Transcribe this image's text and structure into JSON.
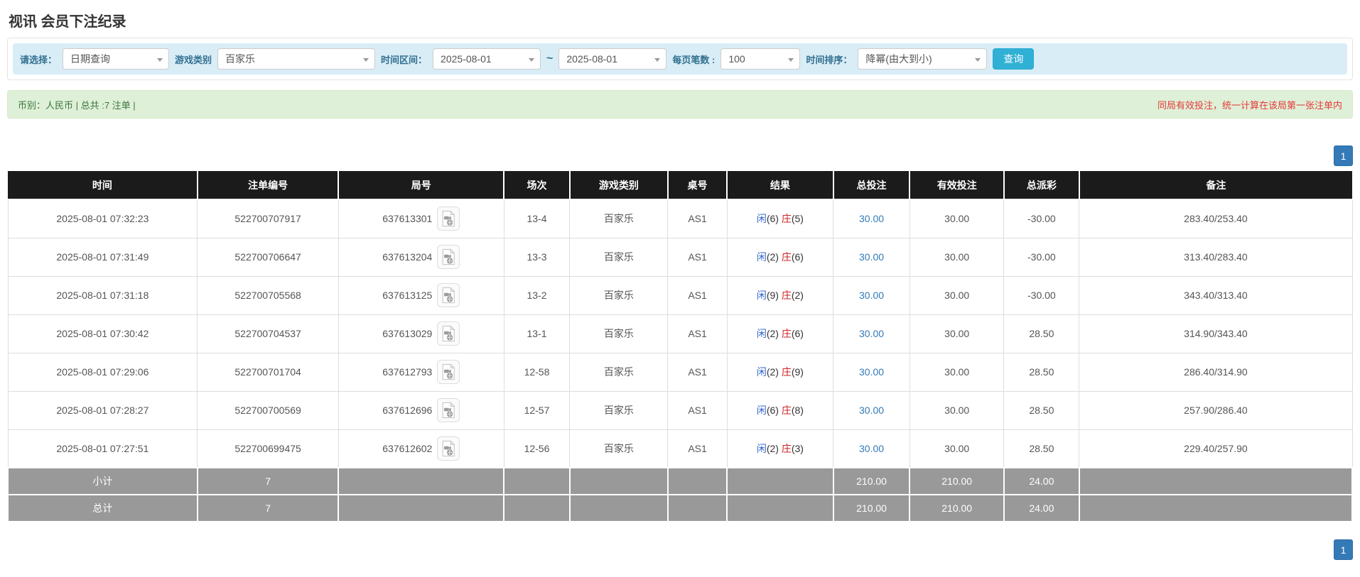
{
  "page": {
    "title": "视讯 会员下注纪录"
  },
  "filters": {
    "select_label": "请选择：",
    "select_value": "日期查询",
    "game_label": "游戏类别",
    "game_value": "百家乐",
    "range_label": "时间区间：",
    "date_from": "2025-08-01",
    "range_sep": "~",
    "date_to": "2025-08-01",
    "per_page_label": "每页笔数 :",
    "per_page_value": "100",
    "sort_label": "时间排序：",
    "sort_value": "降幂(由大到小)",
    "search_button": "查询"
  },
  "summary": {
    "left": "币别：人民币 | 总共 :7 注单 |",
    "right": "同局有效投注，统一计算在该局第一张注单内"
  },
  "pagination": {
    "page": "1"
  },
  "table": {
    "columns": [
      "时间",
      "注单编号",
      "局号",
      "场次",
      "游戏类别",
      "桌号",
      "结果",
      "总投注",
      "有效投注",
      "总派彩",
      "备注"
    ],
    "rows": [
      {
        "time": "2025-08-01 07:32:23",
        "bet_no": "522700707917",
        "round_no": "637613301",
        "session": "13-4",
        "game": "百家乐",
        "table_no": "AS1",
        "player_label": "闲",
        "player_num": "(6)",
        "banker_label": "庄",
        "banker_num": "(5)",
        "total_bet": "30.00",
        "valid_bet": "30.00",
        "payout": "-30.00",
        "remark": "283.40/253.40"
      },
      {
        "time": "2025-08-01 07:31:49",
        "bet_no": "522700706647",
        "round_no": "637613204",
        "session": "13-3",
        "game": "百家乐",
        "table_no": "AS1",
        "player_label": "闲",
        "player_num": "(2)",
        "banker_label": "庄",
        "banker_num": "(6)",
        "total_bet": "30.00",
        "valid_bet": "30.00",
        "payout": "-30.00",
        "remark": "313.40/283.40"
      },
      {
        "time": "2025-08-01 07:31:18",
        "bet_no": "522700705568",
        "round_no": "637613125",
        "session": "13-2",
        "game": "百家乐",
        "table_no": "AS1",
        "player_label": "闲",
        "player_num": "(9)",
        "banker_label": "庄",
        "banker_num": "(2)",
        "total_bet": "30.00",
        "valid_bet": "30.00",
        "payout": "-30.00",
        "remark": "343.40/313.40"
      },
      {
        "time": "2025-08-01 07:30:42",
        "bet_no": "522700704537",
        "round_no": "637613029",
        "session": "13-1",
        "game": "百家乐",
        "table_no": "AS1",
        "player_label": "闲",
        "player_num": "(2)",
        "banker_label": "庄",
        "banker_num": "(6)",
        "total_bet": "30.00",
        "valid_bet": "30.00",
        "payout": "28.50",
        "remark": "314.90/343.40"
      },
      {
        "time": "2025-08-01 07:29:06",
        "bet_no": "522700701704",
        "round_no": "637612793",
        "session": "12-58",
        "game": "百家乐",
        "table_no": "AS1",
        "player_label": "闲",
        "player_num": "(2)",
        "banker_label": "庄",
        "banker_num": "(9)",
        "total_bet": "30.00",
        "valid_bet": "30.00",
        "payout": "28.50",
        "remark": "286.40/314.90"
      },
      {
        "time": "2025-08-01 07:28:27",
        "bet_no": "522700700569",
        "round_no": "637612696",
        "session": "12-57",
        "game": "百家乐",
        "table_no": "AS1",
        "player_label": "闲",
        "player_num": "(6)",
        "banker_label": "庄",
        "banker_num": "(8)",
        "total_bet": "30.00",
        "valid_bet": "30.00",
        "payout": "28.50",
        "remark": "257.90/286.40"
      },
      {
        "time": "2025-08-01 07:27:51",
        "bet_no": "522700699475",
        "round_no": "637612602",
        "session": "12-56",
        "game": "百家乐",
        "table_no": "AS1",
        "player_label": "闲",
        "player_num": "(2)",
        "banker_label": "庄",
        "banker_num": "(3)",
        "total_bet": "30.00",
        "valid_bet": "30.00",
        "payout": "28.50",
        "remark": "229.40/257.90"
      }
    ],
    "subtotal": {
      "label": "小计",
      "count": "7",
      "total_bet": "210.00",
      "valid_bet": "210.00",
      "payout": "24.00"
    },
    "total": {
      "label": "总计",
      "count": "7",
      "total_bet": "210.00",
      "valid_bet": "210.00",
      "payout": "24.00"
    }
  },
  "colors": {
    "accent_search_button": "#31b0d5",
    "pagination_active": "#337ab7",
    "filter_strip_bg": "#d9edf7",
    "filter_label_text": "#31708f",
    "summary_bg": "#dff0d8",
    "summary_text": "#3c763d",
    "warning_text_red": "#e43a3a",
    "header_bg": "#1b1b1b",
    "footer_bg": "#999999",
    "link_blue": "#337ab7",
    "player_blue": "#3366cc",
    "banker_red": "#cc2222",
    "negative_red": "#ee2222"
  },
  "icons": {
    "dropdown_caret": "caret-down",
    "round_video": "video-record-icon"
  }
}
